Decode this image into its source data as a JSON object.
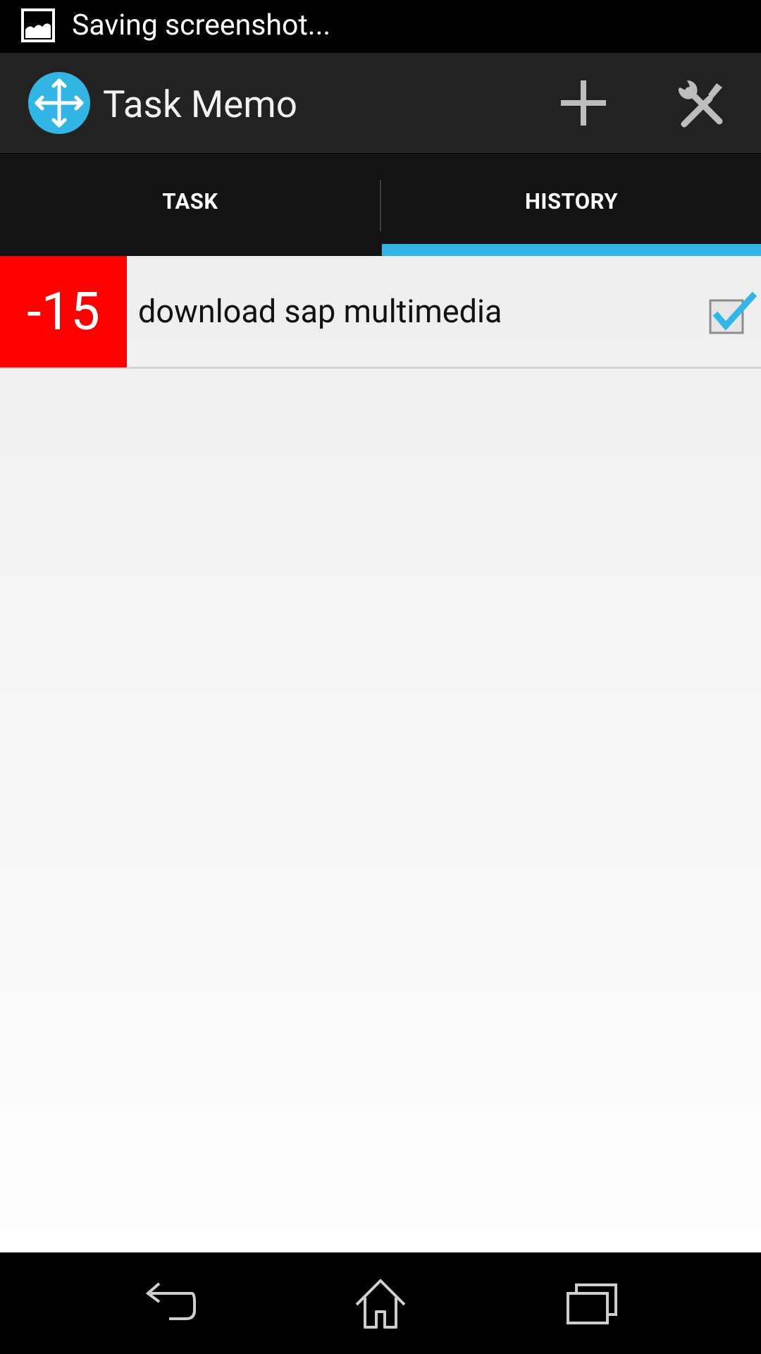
{
  "status_bar": {
    "notification_icon": "image-icon",
    "text": "Saving screenshot..."
  },
  "action_bar": {
    "app_icon": "move-arrows-icon",
    "title": "Task Memo",
    "actions": [
      {
        "name": "add",
        "icon": "plus-icon"
      },
      {
        "name": "settings",
        "icon": "tools-icon"
      }
    ]
  },
  "tabs": [
    {
      "label": "TASK",
      "selected": false
    },
    {
      "label": "HISTORY",
      "selected": true
    }
  ],
  "history": {
    "items": [
      {
        "days": "-15",
        "title": "download sap multimedia",
        "checked": true
      }
    ]
  },
  "colors": {
    "accent": "#33b5e5",
    "badge_overdue": "#ff0000",
    "action_bar": "#222222",
    "tab_bar": "#131313"
  },
  "nav_bar": {
    "buttons": [
      "back-icon",
      "home-icon",
      "recents-icon"
    ]
  }
}
